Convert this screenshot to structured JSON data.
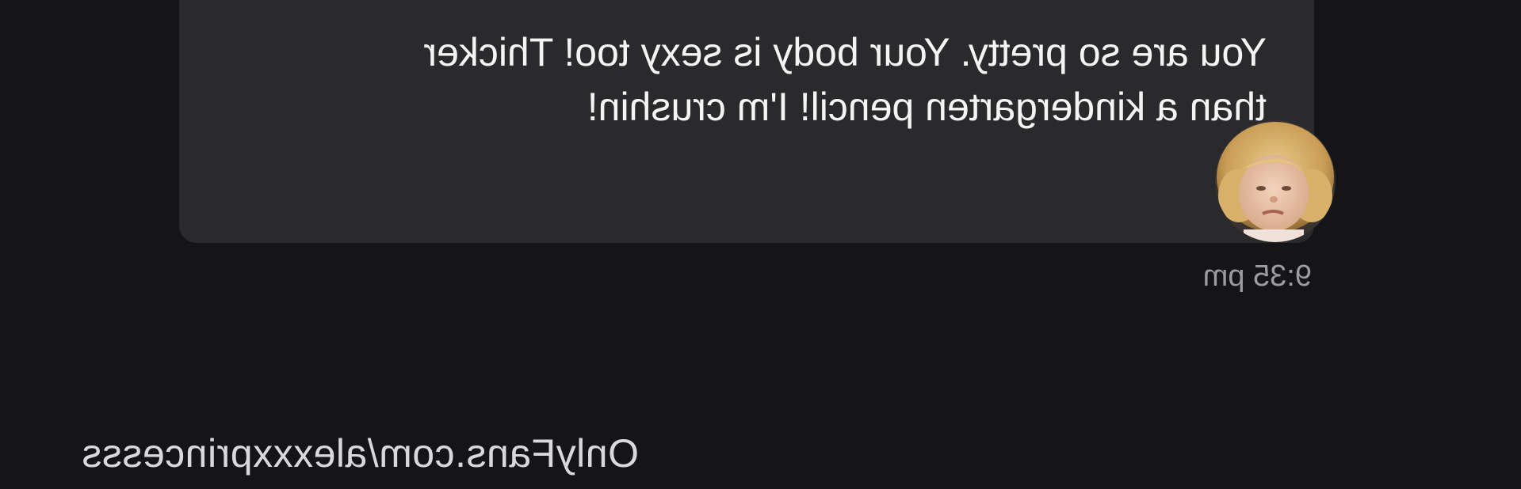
{
  "message": {
    "text": "You are so pretty. Your body is sexy too! Thicker than a kindergarten pencil! I'm crushin!",
    "time": "9:35 pm"
  },
  "sender": {
    "avatar_icon": "user-avatar-photo"
  },
  "watermark": "OnlyFans.com/alexxxprincesss",
  "colors": {
    "background": "#151416",
    "bubble": "#2a2a2c",
    "text": "#f4f4f4",
    "timestamp": "#9c9c9f"
  }
}
